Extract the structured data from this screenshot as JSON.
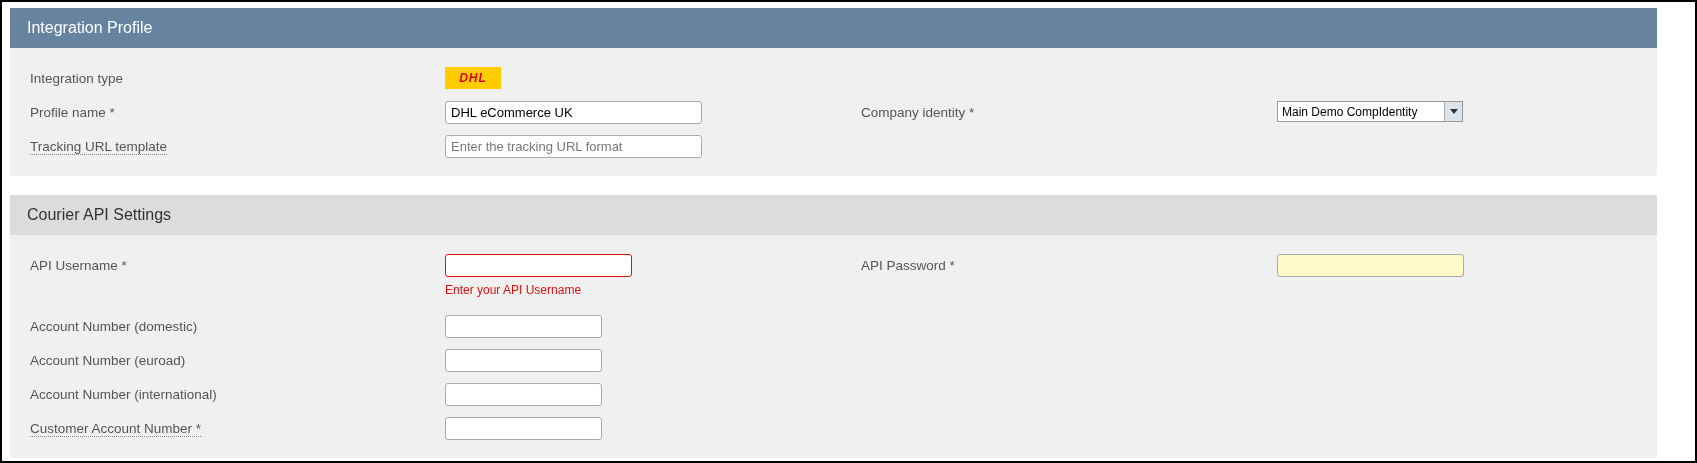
{
  "sections": [
    {
      "title": "Integration Profile",
      "rows": [
        {
          "cells": [
            {
              "label": "Integration type",
              "kind": "logo",
              "value": "DHL"
            }
          ]
        },
        {
          "cells": [
            {
              "label": "Profile name *",
              "kind": "text",
              "value": "DHL eCommerce UK"
            },
            {
              "label": "Company identity *",
              "kind": "select",
              "value": "Main Demo CompIdentity"
            }
          ]
        },
        {
          "cells": [
            {
              "label": "Tracking URL template",
              "has_tooltip": true,
              "kind": "text",
              "placeholder": "Enter the tracking URL format"
            }
          ]
        }
      ]
    },
    {
      "title": "Courier API Settings",
      "rows": [
        {
          "cells": [
            {
              "label": "API Username *",
              "kind": "text",
              "invalid": true,
              "error": "Enter your API Username"
            },
            {
              "label": "API Password *",
              "kind": "text",
              "autofilled": true
            }
          ]
        },
        {
          "cells": [
            {
              "label": "Account Number (domestic)",
              "kind": "text"
            }
          ]
        },
        {
          "cells": [
            {
              "label": "Account Number (euroad)",
              "kind": "text"
            }
          ]
        },
        {
          "cells": [
            {
              "label": "Account Number (international)",
              "kind": "text"
            }
          ]
        },
        {
          "cells": [
            {
              "label": "Customer Account Number *",
              "has_tooltip": true,
              "kind": "text"
            }
          ]
        }
      ]
    }
  ]
}
